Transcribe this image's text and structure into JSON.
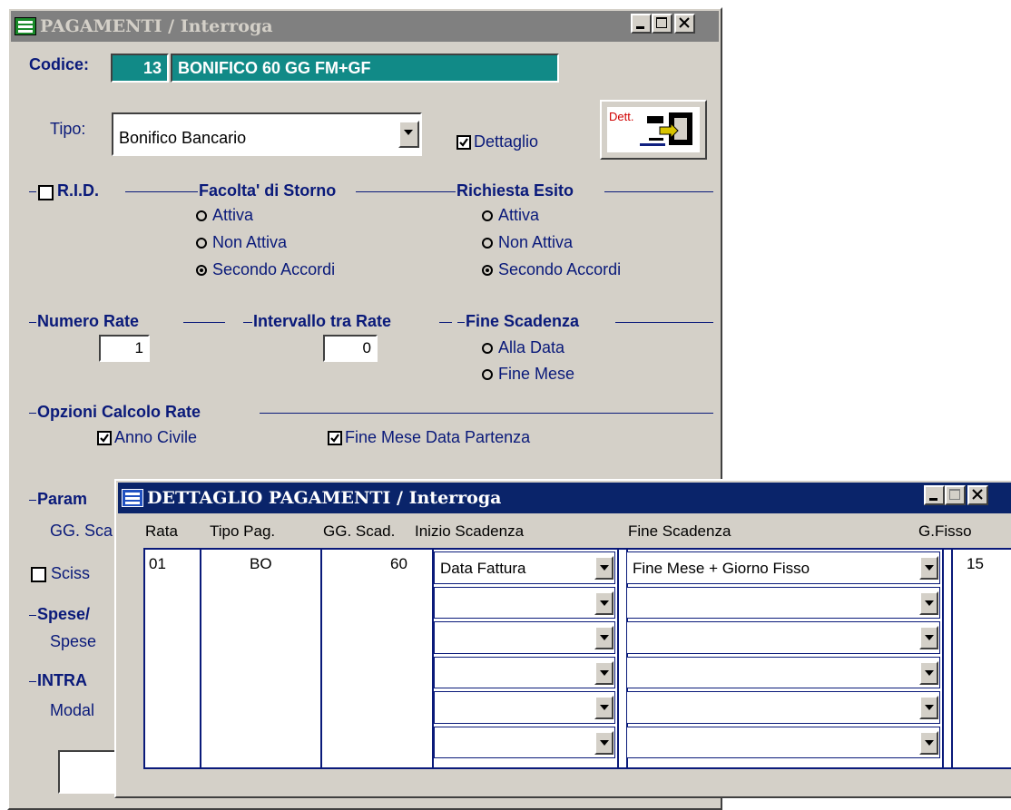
{
  "main_window": {
    "title": "PAGAMENTI / Interroga",
    "codice_label": "Codice:",
    "codice_value": "13",
    "codice_desc": "BONIFICO 60 GG FM+GF",
    "tipo_label": "Tipo:",
    "tipo_value": "Bonifico Bancario",
    "dettaglio_label": "Dettaglio",
    "dettaglio_checked": true,
    "dett_button_label": "Dett.",
    "rid_label": "R.I.D.",
    "facolta_storno": {
      "title": "Facolta' di Storno",
      "options": [
        "Attiva",
        "Non Attiva",
        "Secondo Accordi"
      ],
      "selected": "Secondo Accordi"
    },
    "richiesta_esito": {
      "title": "Richiesta Esito",
      "options": [
        "Attiva",
        "Non Attiva",
        "Secondo Accordi"
      ],
      "selected": "Secondo Accordi"
    },
    "numero_rate_label": "Numero Rate",
    "numero_rate_value": "1",
    "intervallo_label": "Intervallo tra Rate",
    "intervallo_value": "0",
    "fine_scadenza": {
      "title": "Fine Scadenza",
      "options": [
        "Alla Data",
        "Fine Mese"
      ],
      "selected": ""
    },
    "opzioni_title": "Opzioni Calcolo Rate",
    "anno_civile_label": "Anno Civile",
    "fine_mese_partenza_label": "Fine Mese Data Partenza",
    "param_label": "Param",
    "gg_sca_label": "GG. Sca",
    "sciss_label": "Sciss",
    "spese_section_label": "Spese/",
    "spese_label": "Spese",
    "intra_label": "INTRA",
    "modal_label": "Modal"
  },
  "detail_window": {
    "title": "DETTAGLIO PAGAMENTI / Interroga",
    "columns": [
      "Rata",
      "Tipo Pag.",
      "GG. Scad.",
      "Inizio Scadenza",
      "Fine Scadenza",
      "G.Fisso"
    ],
    "rows": [
      {
        "rata": "01",
        "tipo_pag": "BO",
        "gg_scad": "60",
        "inizio": "Data Fattura",
        "fine": "Fine Mese + Giorno Fisso",
        "g_fisso": "15"
      },
      {
        "rata": "",
        "tipo_pag": "",
        "gg_scad": "",
        "inizio": "",
        "fine": "",
        "g_fisso": ""
      },
      {
        "rata": "",
        "tipo_pag": "",
        "gg_scad": "",
        "inizio": "",
        "fine": "",
        "g_fisso": ""
      },
      {
        "rata": "",
        "tipo_pag": "",
        "gg_scad": "",
        "inizio": "",
        "fine": "",
        "g_fisso": ""
      },
      {
        "rata": "",
        "tipo_pag": "",
        "gg_scad": "",
        "inizio": "",
        "fine": "",
        "g_fisso": ""
      },
      {
        "rata": "",
        "tipo_pag": "",
        "gg_scad": "",
        "inizio": "",
        "fine": "",
        "g_fisso": ""
      }
    ]
  },
  "colors": {
    "title_active": "#0a246a",
    "title_inactive": "#808080",
    "teal_field": "#118a87",
    "label_blue": "#0a1a7a",
    "window_face": "#d4d0c8"
  }
}
